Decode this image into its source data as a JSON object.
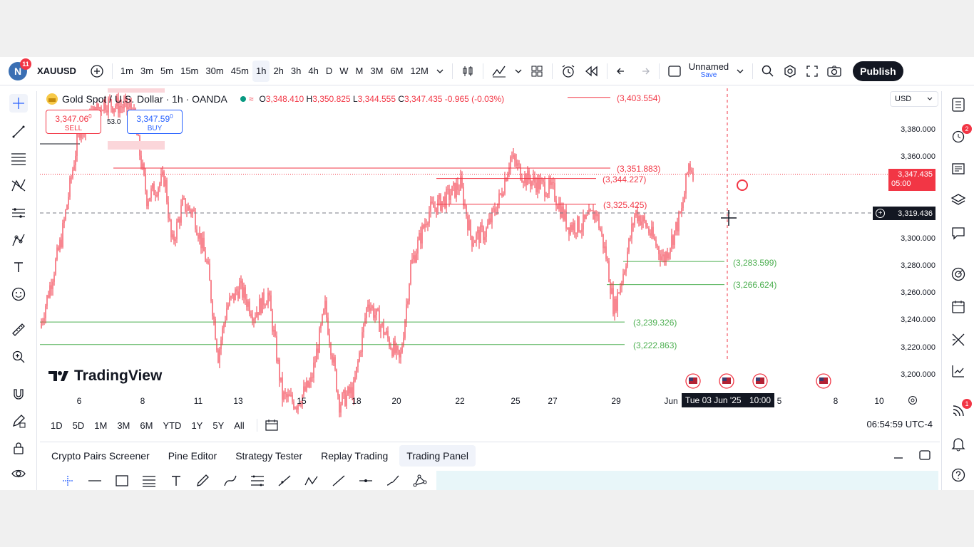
{
  "topbar": {
    "avatar_letter": "N",
    "notification_count": "11",
    "symbol": "XAUUSD",
    "timeframes": [
      "1m",
      "3m",
      "5m",
      "15m",
      "30m",
      "45m",
      "1h",
      "2h",
      "3h",
      "4h",
      "D",
      "W",
      "M",
      "3M",
      "6M",
      "12M"
    ],
    "active_timeframe": "1h",
    "layout_name": "Unnamed",
    "layout_save": "Save",
    "publish_label": "Publish"
  },
  "legend": {
    "title": "Gold Spot / U.S. Dollar · 1h · OANDA",
    "open_label": "O",
    "open": "3,348.410",
    "high_label": "H",
    "high": "3,350.825",
    "low_label": "L",
    "low": "3,344.555",
    "close_label": "C",
    "close": "3,347.435",
    "change": "-0.965 (-0.03%)"
  },
  "trade": {
    "sell_price": "3,347.06",
    "sell_sup": "0",
    "sell_label": "SELL",
    "spread": "53.0",
    "buy_price": "3,347.59",
    "buy_sup": "0",
    "buy_label": "BUY"
  },
  "price_scale": {
    "currency": "USD",
    "labels": [
      "3,380.000",
      "3,360.000",
      "3,300.000",
      "3,280.000",
      "3,260.000",
      "3,240.000",
      "3,220.000",
      "3,200.000"
    ],
    "current_price": "3,347.435",
    "countdown": "05:00",
    "crosshair_price": "3,319.436"
  },
  "levels": {
    "red": [
      "(3,403.554)",
      "(3,351.883)",
      "(3,344.227)",
      "(3,325.425)"
    ],
    "green": [
      "(3,283.599)",
      "(3,266.624)",
      "(3,239.326)",
      "(3,222.863)"
    ]
  },
  "time_axis": {
    "labels": [
      "6",
      "8",
      "11",
      "13",
      "15",
      "18",
      "20",
      "22",
      "25",
      "27",
      "29",
      "Jun",
      "5",
      "8",
      "10"
    ],
    "crosshair_label": "Tue 03 Jun '25",
    "crosshair_time": "10:00"
  },
  "watermark": "TradingView",
  "ranges": [
    "1D",
    "5D",
    "1M",
    "3M",
    "6M",
    "YTD",
    "1Y",
    "5Y",
    "All"
  ],
  "clock": "06:54:59 UTC-4",
  "bottom_tabs": [
    "Crypto Pairs Screener",
    "Pine Editor",
    "Strategy Tester",
    "Replay Trading",
    "Trading Panel"
  ],
  "active_bottom_tab": "Trading Panel",
  "right_badges": {
    "alerts": "2",
    "notifications": "1"
  },
  "colors": {
    "up": "#f23645",
    "down": "#f23645",
    "red_level": "#f23645",
    "green_level": "#4caf50",
    "accent": "#2962ff"
  }
}
